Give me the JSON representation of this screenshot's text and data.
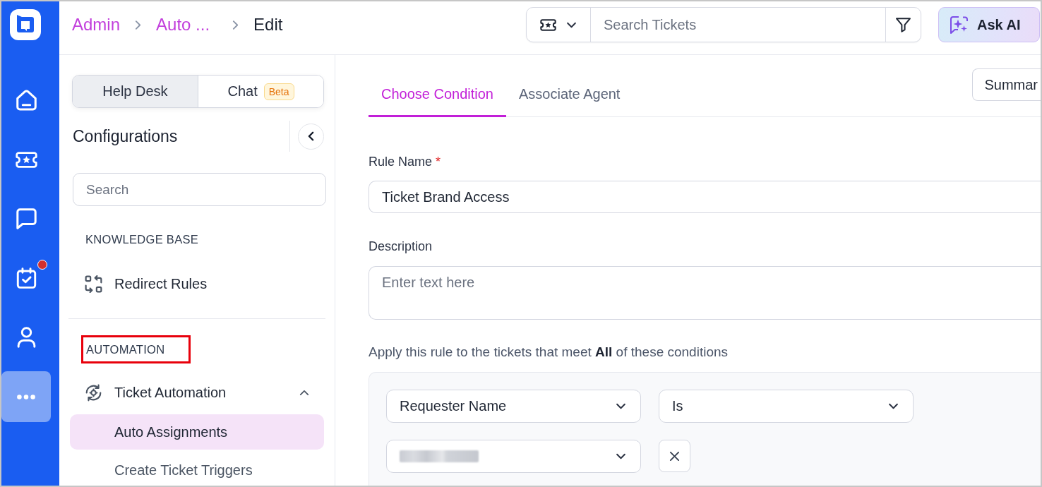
{
  "rail": {
    "items": [
      {
        "kind": "home",
        "selected": false,
        "notification": false
      },
      {
        "kind": "tickets",
        "selected": false,
        "notification": false
      },
      {
        "kind": "chat",
        "selected": false,
        "notification": false
      },
      {
        "kind": "tasks",
        "selected": false,
        "notification": true
      },
      {
        "kind": "contacts",
        "selected": false,
        "notification": false
      },
      {
        "kind": "more",
        "selected": true,
        "notification": false
      }
    ]
  },
  "breadcrumb": [
    {
      "label": "Admin",
      "kind": "link"
    },
    {
      "label": "Auto ...",
      "kind": "link"
    },
    {
      "label": "Edit",
      "kind": "current"
    }
  ],
  "search": {
    "placeholder": "Search Tickets"
  },
  "ask_ai": {
    "label": "Ask AI"
  },
  "config": {
    "toggle": [
      {
        "label": "Help Desk",
        "selected": true
      },
      {
        "label": "Chat",
        "selected": false,
        "badge": "Beta"
      }
    ],
    "title": "Configurations",
    "search": {
      "placeholder": "Search"
    },
    "sections": [
      {
        "heading": "KNOWLEDGE BASE",
        "highlighted": false,
        "items": [
          {
            "label": "Redirect Rules",
            "kind": "redirect"
          }
        ]
      },
      {
        "heading": "AUTOMATION",
        "highlighted": true,
        "items": [
          {
            "label": "Ticket Automation",
            "kind": "automation",
            "expanded": true,
            "children": [
              {
                "label": "Auto Assignments",
                "selected": true
              },
              {
                "label": "Create Ticket Triggers",
                "selected": false
              }
            ]
          }
        ]
      }
    ]
  },
  "tabs": [
    {
      "label": "Choose Condition",
      "selected": true
    },
    {
      "label": "Associate Agent",
      "selected": false
    }
  ],
  "summary_button": {
    "label": "Summar"
  },
  "form": {
    "rule_name": {
      "label": "Rule Name",
      "required_mark": "*",
      "value": "Ticket Brand Access"
    },
    "description": {
      "label": "Description",
      "placeholder": "Enter text here"
    },
    "conditions_intro": "Apply this rule to the tickets that meet **All** of these conditions",
    "conditions": [
      {
        "field": "Requester Name",
        "operator": "Is",
        "value": {
          "redacted": true
        }
      }
    ]
  }
}
